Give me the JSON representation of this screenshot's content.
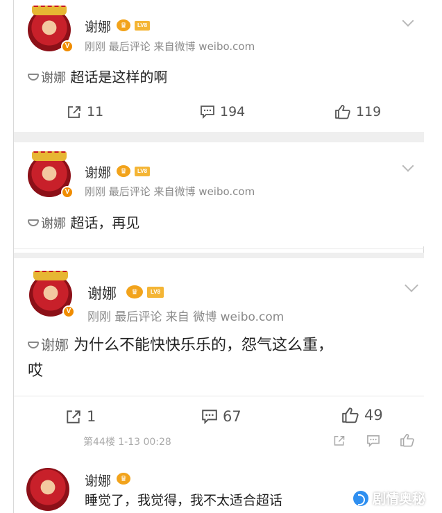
{
  "posts": [
    {
      "username": "谢娜",
      "crown": "♛",
      "level": "LV8",
      "verified": "V",
      "meta": "刚刚 最后评论  来自微博 weibo.com",
      "tag": "谢娜",
      "text": "超话是这样的啊",
      "actions": {
        "repost": "11",
        "comment": "194",
        "like": "119"
      }
    },
    {
      "username": "谢娜",
      "crown": "♛",
      "level": "LV8",
      "verified": "V",
      "meta": "刚刚 最后评论  来自微博 weibo.com",
      "tag": "谢娜",
      "text": "超话，再见"
    },
    {
      "username": "谢娜",
      "crown": "♛",
      "level": "LV8",
      "verified": "V",
      "meta": "刚刚 最后评论  来自 微博 weibo.com",
      "tag": "谢娜",
      "text": "为什么不能快快乐乐的，怨气这么重，",
      "text2": "哎",
      "actions": {
        "repost": "1",
        "comment": "67",
        "like": "49"
      },
      "floor": "第44楼 1-13 00:28"
    },
    {
      "username": "谢娜",
      "crown": "♛",
      "text": "睡觉了，我觉得，我不太适合超话"
    }
  ],
  "watermark": "剧情奥秘",
  "icons": {
    "repost": "share-box-icon",
    "comment": "comment-bubble-icon",
    "like": "thumbs-up-icon",
    "dropdown": "chevron-down-icon"
  },
  "colors": {
    "badge": "#f2a31b",
    "avatar": "#c8202a",
    "gap": "#efefef"
  }
}
